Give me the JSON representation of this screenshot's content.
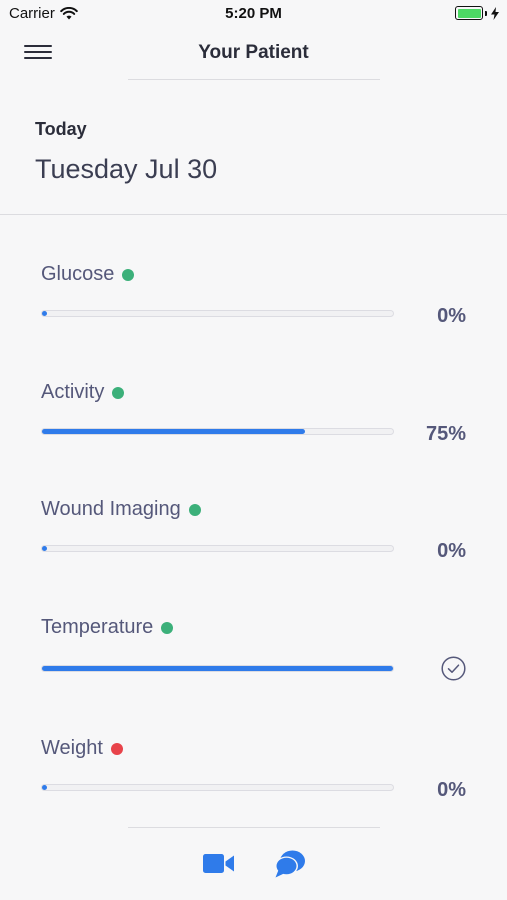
{
  "status_bar": {
    "carrier": "Carrier",
    "time": "5:20 PM",
    "battery_level": 1.0,
    "battery_color": "#4cd964"
  },
  "header": {
    "menu_icon": "hamburger-menu-icon",
    "title": "Your Patient"
  },
  "date": {
    "label": "Today",
    "value": "Tuesday Jul 30"
  },
  "metrics": [
    {
      "label": "Glucose",
      "status_color": "#3cb07a",
      "progress": 0,
      "percent_text": "0%"
    },
    {
      "label": "Activity",
      "status_color": "#3cb07a",
      "progress": 0.75,
      "percent_text": "75%"
    },
    {
      "label": "Wound Imaging",
      "status_color": "#3cb07a",
      "progress": 0,
      "percent_text": "0%"
    },
    {
      "label": "Temperature",
      "status_color": "#3cb07a",
      "progress": 1.0,
      "completed": true,
      "completed_icon": "check-circle-icon"
    },
    {
      "label": "Weight",
      "status_color": "#e8434a",
      "progress": 0,
      "percent_text": "0%"
    }
  ],
  "bottom_bar": {
    "video_icon": "video-camera-icon",
    "chat_icon": "chat-bubbles-icon",
    "accent_color": "#2f7bea"
  }
}
